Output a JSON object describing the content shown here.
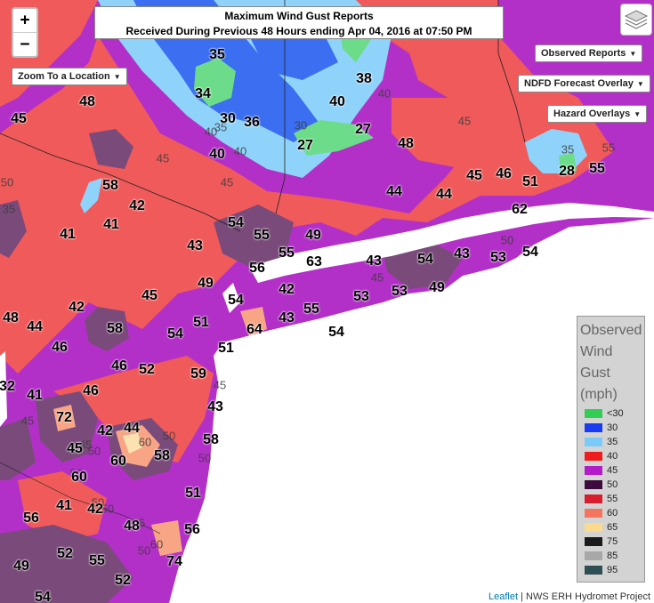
{
  "title": {
    "line1": "Maximum Wind Gust Reports",
    "line2": "Received During Previous 48 Hours ending Apr 04, 2016 at 07:50 PM"
  },
  "controls": {
    "zoom_in": "+",
    "zoom_out": "−",
    "zoom_location": "Zoom To a Location",
    "observed_reports": "Observed Reports",
    "ndfd_overlay": "NDFD Forecast Overlay",
    "hazard_overlays": "Hazard Overlays"
  },
  "legend": {
    "title_lines": [
      "Observed",
      "Wind",
      "Gust",
      "(mph)"
    ],
    "items": [
      {
        "label": "<30",
        "color": "#33cc55"
      },
      {
        "label": "30",
        "color": "#1a3cf0"
      },
      {
        "label": "35",
        "color": "#7ccafa"
      },
      {
        "label": "40",
        "color": "#ee1c1c"
      },
      {
        "label": "45",
        "color": "#b31cc8"
      },
      {
        "label": "50",
        "color": "#3d0a3d"
      },
      {
        "label": "55",
        "color": "#d81e2e"
      },
      {
        "label": "60",
        "color": "#f4755f"
      },
      {
        "label": "65",
        "color": "#fbd98e"
      },
      {
        "label": "75",
        "color": "#1a1a1a"
      },
      {
        "label": "85",
        "color": "#a8a8a8"
      },
      {
        "label": "95",
        "color": "#2f4f55"
      }
    ]
  },
  "attribution": {
    "leaflet": "Leaflet",
    "source": "| NWS ERH Hydromet Project"
  },
  "observations": [
    "35",
    "34",
    "30",
    "36",
    "38",
    "40",
    "27",
    "27",
    "48",
    "45",
    "40",
    "48",
    "58",
    "42",
    "44",
    "41",
    "45",
    "44",
    "46",
    "51",
    "62",
    "55",
    "28",
    "54",
    "55",
    "49",
    "43",
    "56",
    "55",
    "63",
    "43",
    "54",
    "43",
    "53",
    "54",
    "41",
    "49",
    "42",
    "45",
    "54",
    "42",
    "43",
    "55",
    "53",
    "53",
    "49",
    "48",
    "58",
    "64",
    "51",
    "54",
    "44",
    "46",
    "51",
    "54",
    "46",
    "52",
    "59",
    "32",
    "41",
    "46",
    "43",
    "72",
    "44",
    "42",
    "45",
    "58",
    "60",
    "58",
    "60",
    "51",
    "56",
    "41",
    "42",
    "48",
    "56",
    "49",
    "52",
    "55",
    "74",
    "52",
    "54"
  ],
  "isolines": [
    "45",
    "40",
    "35",
    "30",
    "40",
    "40",
    "45",
    "45",
    "45",
    "35",
    "55",
    "45",
    "50",
    "50",
    "45",
    "50",
    "35",
    "45",
    "60",
    "50",
    "55",
    "50",
    "60",
    "45",
    "50",
    "50",
    "50",
    "50"
  ]
}
